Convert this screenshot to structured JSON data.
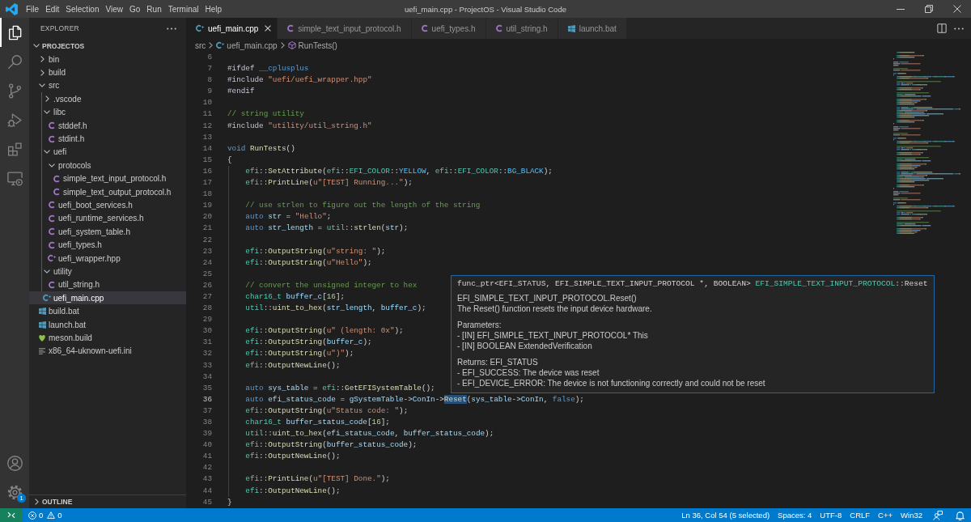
{
  "title_bar": {
    "menus": [
      "File",
      "Edit",
      "Selection",
      "View",
      "Go",
      "Run",
      "Terminal",
      "Help"
    ],
    "title": "uefi_main.cpp - ProjectOS - Visual Studio Code"
  },
  "activity_bar": {
    "items": [
      {
        "kind": "explorer",
        "selected": true
      },
      {
        "kind": "search",
        "selected": false
      },
      {
        "kind": "source_control",
        "selected": false
      },
      {
        "kind": "run_debug",
        "selected": false
      },
      {
        "kind": "extensions",
        "selected": false
      },
      {
        "kind": "remote_explorer",
        "selected": false
      }
    ],
    "bottom": [
      {
        "kind": "account"
      },
      {
        "kind": "settings",
        "badge": "1"
      }
    ]
  },
  "sidebar": {
    "title": "EXPLORER",
    "section": {
      "label": "PROJECTOS",
      "expanded": true
    },
    "tree": [
      {
        "label": "bin",
        "kind": "folder",
        "expanded": false,
        "selected": false
      },
      {
        "label": "build",
        "kind": "folder",
        "expanded": false,
        "selected": false
      },
      {
        "label": "src",
        "kind": "folder",
        "expanded": true,
        "selected": false,
        "children": [
          {
            "label": ".vscode",
            "kind": "folder",
            "expanded": false,
            "selected": false
          },
          {
            "label": "libc",
            "kind": "folder",
            "expanded": true,
            "selected": false,
            "children": [
              {
                "label": "stddef.h",
                "kind": "c_header",
                "selected": false
              },
              {
                "label": "stdint.h",
                "kind": "c_header",
                "selected": false
              }
            ]
          },
          {
            "label": "uefi",
            "kind": "folder",
            "expanded": true,
            "selected": false,
            "children": [
              {
                "label": "protocols",
                "kind": "folder",
                "expanded": true,
                "selected": false,
                "children": [
                  {
                    "label": "simple_text_input_protocol.h",
                    "kind": "c_header",
                    "selected": false
                  },
                  {
                    "label": "simple_text_output_protocol.h",
                    "kind": "c_header",
                    "selected": false
                  }
                ]
              },
              {
                "label": "uefi_boot_services.h",
                "kind": "c_header",
                "selected": false
              },
              {
                "label": "uefi_runtime_services.h",
                "kind": "c_header",
                "selected": false
              },
              {
                "label": "uefi_system_table.h",
                "kind": "c_header",
                "selected": false
              },
              {
                "label": "uefi_types.h",
                "kind": "c_header",
                "selected": false
              },
              {
                "label": "uefi_wrapper.hpp",
                "kind": "cpp_header",
                "selected": false
              }
            ]
          },
          {
            "label": "utility",
            "kind": "folder",
            "expanded": true,
            "selected": false,
            "children": [
              {
                "label": "util_string.h",
                "kind": "c_header",
                "selected": false
              }
            ]
          },
          {
            "label": "uefi_main.cpp",
            "kind": "cpp_source",
            "selected": true
          }
        ]
      },
      {
        "label": "build.bat",
        "kind": "batch",
        "selected": false
      },
      {
        "label": "launch.bat",
        "kind": "batch",
        "selected": false
      },
      {
        "label": "meson.build",
        "kind": "meson",
        "selected": false
      },
      {
        "label": "x86_64-uknown-uefi.ini",
        "kind": "settings_file",
        "selected": false
      }
    ],
    "outline": {
      "label": "OUTLINE",
      "expanded": false
    }
  },
  "tabs": [
    {
      "label": "uefi_main.cpp",
      "kind": "cpp_source",
      "selected": true
    },
    {
      "label": "simple_text_input_protocol.h",
      "kind": "c_header",
      "selected": false
    },
    {
      "label": "uefi_types.h",
      "kind": "c_header",
      "selected": false
    },
    {
      "label": "util_string.h",
      "kind": "c_header",
      "selected": false
    },
    {
      "label": "launch.bat",
      "kind": "batch",
      "selected": false
    }
  ],
  "breadcrumbs": [
    {
      "label": "src",
      "kind": "folder"
    },
    {
      "label": "uefi_main.cpp",
      "kind": "cpp_source"
    },
    {
      "label": "RunTests()",
      "kind": "symbol"
    }
  ],
  "editor": {
    "lines": [
      {
        "number": "6",
        "current": false
      },
      {
        "number": "7",
        "current": false,
        "tokens": [
          {
            "kind": "directive",
            "text": "#ifdef "
          },
          {
            "kind": "macro",
            "text": "__cplusplus"
          }
        ]
      },
      {
        "number": "8",
        "current": false,
        "tokens": [
          {
            "kind": "directive",
            "text": "#include "
          },
          {
            "kind": "string",
            "text": "\"uefi/uefi_wrapper.hpp\""
          }
        ]
      },
      {
        "number": "9",
        "current": false,
        "tokens": [
          {
            "kind": "directive",
            "text": "#endif"
          }
        ]
      },
      {
        "number": "10",
        "current": false
      },
      {
        "number": "11",
        "current": false,
        "tokens": [
          {
            "kind": "comment",
            "text": "// string utility"
          }
        ]
      },
      {
        "number": "12",
        "current": false,
        "tokens": [
          {
            "kind": "directive",
            "text": "#include "
          },
          {
            "kind": "string",
            "text": "\"utility/util_string.h\""
          }
        ]
      },
      {
        "number": "13",
        "current": false
      },
      {
        "number": "14",
        "current": false,
        "tokens": [
          {
            "kind": "keyword",
            "text": "void "
          },
          {
            "kind": "function",
            "text": "RunTests"
          },
          {
            "kind": "plain",
            "text": "()"
          }
        ]
      },
      {
        "number": "15",
        "current": false,
        "tokens": [
          {
            "kind": "plain",
            "text": "{"
          }
        ]
      },
      {
        "number": "16",
        "current": false,
        "tokens": [
          {
            "kind": "namespace",
            "text": "    efi"
          },
          {
            "kind": "plain",
            "text": "::"
          },
          {
            "kind": "function",
            "text": "SetAttribute"
          },
          {
            "kind": "plain",
            "text": "("
          },
          {
            "kind": "namespace",
            "text": "efi"
          },
          {
            "kind": "plain",
            "text": "::"
          },
          {
            "kind": "type",
            "text": "EFI_COLOR"
          },
          {
            "kind": "plain",
            "text": "::"
          },
          {
            "kind": "enum",
            "text": "YELLOW"
          },
          {
            "kind": "plain",
            "text": ", "
          },
          {
            "kind": "namespace",
            "text": "efi"
          },
          {
            "kind": "plain",
            "text": "::"
          },
          {
            "kind": "type",
            "text": "EFI_COLOR"
          },
          {
            "kind": "plain",
            "text": "::"
          },
          {
            "kind": "enum",
            "text": "BG_BLACK"
          },
          {
            "kind": "plain",
            "text": ");"
          }
        ]
      },
      {
        "number": "17",
        "current": false,
        "tokens": [
          {
            "kind": "namespace",
            "text": "    efi"
          },
          {
            "kind": "plain",
            "text": "::"
          },
          {
            "kind": "function",
            "text": "PrintLine"
          },
          {
            "kind": "plain",
            "text": "("
          },
          {
            "kind": "string",
            "text": "u\"[TEST] Running...\""
          },
          {
            "kind": "plain",
            "text": ");"
          }
        ]
      },
      {
        "number": "18",
        "current": false
      },
      {
        "number": "19",
        "current": false,
        "tokens": [
          {
            "kind": "comment",
            "text": "    // use strlen to figure out the length of the string"
          }
        ]
      },
      {
        "number": "20",
        "current": false,
        "tokens": [
          {
            "kind": "keyword",
            "text": "    auto "
          },
          {
            "kind": "variable",
            "text": "str"
          },
          {
            "kind": "plain",
            "text": " = "
          },
          {
            "kind": "string",
            "text": "\"Hello\""
          },
          {
            "kind": "plain",
            "text": ";"
          }
        ]
      },
      {
        "number": "21",
        "current": false,
        "tokens": [
          {
            "kind": "keyword",
            "text": "    auto "
          },
          {
            "kind": "variable",
            "text": "str_length"
          },
          {
            "kind": "plain",
            "text": " = "
          },
          {
            "kind": "namespace",
            "text": "util"
          },
          {
            "kind": "plain",
            "text": "::"
          },
          {
            "kind": "function",
            "text": "strlen"
          },
          {
            "kind": "plain",
            "text": "("
          },
          {
            "kind": "variable",
            "text": "str"
          },
          {
            "kind": "plain",
            "text": ");"
          }
        ]
      },
      {
        "number": "22",
        "current": false
      },
      {
        "number": "23",
        "current": false,
        "tokens": [
          {
            "kind": "namespace",
            "text": "    efi"
          },
          {
            "kind": "plain",
            "text": "::"
          },
          {
            "kind": "function",
            "text": "OutputString"
          },
          {
            "kind": "plain",
            "text": "("
          },
          {
            "kind": "string",
            "text": "u\"string: \""
          },
          {
            "kind": "plain",
            "text": ");"
          }
        ]
      },
      {
        "number": "24",
        "current": false,
        "tokens": [
          {
            "kind": "namespace",
            "text": "    efi"
          },
          {
            "kind": "plain",
            "text": "::"
          },
          {
            "kind": "function",
            "text": "OutputString"
          },
          {
            "kind": "plain",
            "text": "("
          },
          {
            "kind": "string",
            "text": "u\"Hello\""
          },
          {
            "kind": "plain",
            "text": ");"
          }
        ]
      },
      {
        "number": "25",
        "current": false
      },
      {
        "number": "26",
        "current": false,
        "tokens": [
          {
            "kind": "comment",
            "text": "    // convert the unsigned integer to hex"
          }
        ]
      },
      {
        "number": "27",
        "current": false,
        "tokens": [
          {
            "kind": "type",
            "text": "    char16_t "
          },
          {
            "kind": "variable",
            "text": "buffer_c"
          },
          {
            "kind": "plain",
            "text": "["
          },
          {
            "kind": "number",
            "text": "16"
          },
          {
            "kind": "plain",
            "text": "];"
          }
        ]
      },
      {
        "number": "28",
        "current": false,
        "tokens": [
          {
            "kind": "namespace",
            "text": "    util"
          },
          {
            "kind": "plain",
            "text": "::"
          },
          {
            "kind": "function",
            "text": "uint_to_hex"
          },
          {
            "kind": "plain",
            "text": "("
          },
          {
            "kind": "variable",
            "text": "str_length"
          },
          {
            "kind": "plain",
            "text": ", "
          },
          {
            "kind": "variable",
            "text": "buffer_c"
          },
          {
            "kind": "plain",
            "text": ");"
          }
        ]
      },
      {
        "number": "29",
        "current": false
      },
      {
        "number": "30",
        "current": false,
        "tokens": [
          {
            "kind": "namespace",
            "text": "    efi"
          },
          {
            "kind": "plain",
            "text": "::"
          },
          {
            "kind": "function",
            "text": "OutputString"
          },
          {
            "kind": "plain",
            "text": "("
          },
          {
            "kind": "string",
            "text": "u\" (length: 0x\""
          },
          {
            "kind": "plain",
            "text": ");"
          }
        ]
      },
      {
        "number": "31",
        "current": false,
        "tokens": [
          {
            "kind": "namespace",
            "text": "    efi"
          },
          {
            "kind": "plain",
            "text": "::"
          },
          {
            "kind": "function",
            "text": "OutputString"
          },
          {
            "kind": "plain",
            "text": "("
          },
          {
            "kind": "variable",
            "text": "buffer_c"
          },
          {
            "kind": "plain",
            "text": ");"
          }
        ]
      },
      {
        "number": "32",
        "current": false,
        "tokens": [
          {
            "kind": "namespace",
            "text": "    efi"
          },
          {
            "kind": "plain",
            "text": "::"
          },
          {
            "kind": "function",
            "text": "OutputString"
          },
          {
            "kind": "plain",
            "text": "("
          },
          {
            "kind": "string",
            "text": "u\")\""
          },
          {
            "kind": "plain",
            "text": ");"
          }
        ]
      },
      {
        "number": "33",
        "current": false,
        "tokens": [
          {
            "kind": "namespace",
            "text": "    efi"
          },
          {
            "kind": "plain",
            "text": "::"
          },
          {
            "kind": "function",
            "text": "OutputNewLine"
          },
          {
            "kind": "plain",
            "text": "();"
          }
        ]
      },
      {
        "number": "34",
        "current": false
      },
      {
        "number": "35",
        "current": false,
        "tokens": [
          {
            "kind": "keyword",
            "text": "    auto "
          },
          {
            "kind": "variable",
            "text": "sys_table"
          },
          {
            "kind": "plain",
            "text": " = "
          },
          {
            "kind": "namespace",
            "text": "efi"
          },
          {
            "kind": "plain",
            "text": "::"
          },
          {
            "kind": "function",
            "text": "GetEFISystemTable"
          },
          {
            "kind": "plain",
            "text": "();"
          }
        ]
      },
      {
        "number": "36",
        "current": true,
        "tokens": [
          {
            "kind": "keyword",
            "text": "    auto "
          },
          {
            "kind": "variable",
            "text": "efi_status_code"
          },
          {
            "kind": "plain",
            "text": " = "
          },
          {
            "kind": "variable",
            "text": "gSystemTable"
          },
          {
            "kind": "plain",
            "text": "->"
          },
          {
            "kind": "variable",
            "text": "ConIn"
          },
          {
            "kind": "plain",
            "text": "->"
          },
          {
            "kind": "function",
            "text": "Reset",
            "selected": true
          },
          {
            "kind": "plain",
            "text": "("
          },
          {
            "kind": "variable",
            "text": "sys_table"
          },
          {
            "kind": "plain",
            "text": "->"
          },
          {
            "kind": "variable",
            "text": "ConIn"
          },
          {
            "kind": "plain",
            "text": ", "
          },
          {
            "kind": "keyword",
            "text": "false"
          },
          {
            "kind": "plain",
            "text": ");"
          }
        ]
      },
      {
        "number": "37",
        "current": false,
        "tokens": [
          {
            "kind": "namespace",
            "text": "    efi"
          },
          {
            "kind": "plain",
            "text": "::"
          },
          {
            "kind": "function",
            "text": "OutputString"
          },
          {
            "kind": "plain",
            "text": "("
          },
          {
            "kind": "string",
            "text": "u\"Status code: \""
          },
          {
            "kind": "plain",
            "text": ");"
          }
        ]
      },
      {
        "number": "38",
        "current": false,
        "tokens": [
          {
            "kind": "type",
            "text": "    char16_t "
          },
          {
            "kind": "variable",
            "text": "buffer_status_code"
          },
          {
            "kind": "plain",
            "text": "["
          },
          {
            "kind": "number",
            "text": "16"
          },
          {
            "kind": "plain",
            "text": "];"
          }
        ]
      },
      {
        "number": "39",
        "current": false,
        "tokens": [
          {
            "kind": "namespace",
            "text": "    util"
          },
          {
            "kind": "plain",
            "text": "::"
          },
          {
            "kind": "function",
            "text": "uint_to_hex"
          },
          {
            "kind": "plain",
            "text": "("
          },
          {
            "kind": "variable",
            "text": "efi_status_code"
          },
          {
            "kind": "plain",
            "text": ", "
          },
          {
            "kind": "variable",
            "text": "buffer_status_code"
          },
          {
            "kind": "plain",
            "text": ");"
          }
        ]
      },
      {
        "number": "40",
        "current": false,
        "tokens": [
          {
            "kind": "namespace",
            "text": "    efi"
          },
          {
            "kind": "plain",
            "text": "::"
          },
          {
            "kind": "function",
            "text": "OutputString"
          },
          {
            "kind": "plain",
            "text": "("
          },
          {
            "kind": "variable",
            "text": "buffer_status_code"
          },
          {
            "kind": "plain",
            "text": ");"
          }
        ]
      },
      {
        "number": "41",
        "current": false,
        "tokens": [
          {
            "kind": "namespace",
            "text": "    efi"
          },
          {
            "kind": "plain",
            "text": "::"
          },
          {
            "kind": "function",
            "text": "OutputNewLine"
          },
          {
            "kind": "plain",
            "text": "();"
          }
        ]
      },
      {
        "number": "42",
        "current": false
      },
      {
        "number": "43",
        "current": false,
        "tokens": [
          {
            "kind": "namespace",
            "text": "    efi"
          },
          {
            "kind": "plain",
            "text": "::"
          },
          {
            "kind": "function",
            "text": "PrintLine"
          },
          {
            "kind": "plain",
            "text": "("
          },
          {
            "kind": "string",
            "text": "u\"[TEST] Done.\""
          },
          {
            "kind": "plain",
            "text": ");"
          }
        ]
      },
      {
        "number": "44",
        "current": false,
        "tokens": [
          {
            "kind": "namespace",
            "text": "    efi"
          },
          {
            "kind": "plain",
            "text": "::"
          },
          {
            "kind": "function",
            "text": "OutputNewLine"
          },
          {
            "kind": "plain",
            "text": "();"
          }
        ]
      },
      {
        "number": "45",
        "current": false,
        "tokens": [
          {
            "kind": "plain",
            "text": "}"
          }
        ]
      }
    ]
  },
  "hover": {
    "signature": [
      {
        "kind": "plain",
        "text": "func_ptr<EFI_STATUS, EFI_SIMPLE_TEXT_INPUT_PROTOCOL *, BOOLEAN> "
      },
      {
        "kind": "type",
        "text": "EFI_SIMPLE_TEXT_INPUT_PROTOCOL"
      },
      {
        "kind": "plain",
        "text": "::Reset"
      }
    ],
    "paragraphs": [
      [
        "EFI_SIMPLE_TEXT_INPUT_PROTOCOL.Reset()",
        "The Reset() function resets the input device hardware."
      ],
      [
        "Parameters:",
        "- [IN] EFI_SIMPLE_TEXT_INPUT_PROTOCOL* This",
        "- [IN] BOOLEAN ExtendedVerification"
      ],
      [
        "Returns: EFI_STATUS",
        "- EFI_SUCCESS: The device was reset",
        "- EFI_DEVICE_ERROR: The device is not functioning correctly and could not be reset"
      ]
    ]
  },
  "status_bar": {
    "problems": {
      "errors": "0",
      "warnings": "0"
    },
    "items": [
      "Ln 36, Col 54 (5 selected)",
      "Spaces: 4",
      "UTF-8",
      "CRLF",
      "C++",
      "Win32"
    ]
  }
}
